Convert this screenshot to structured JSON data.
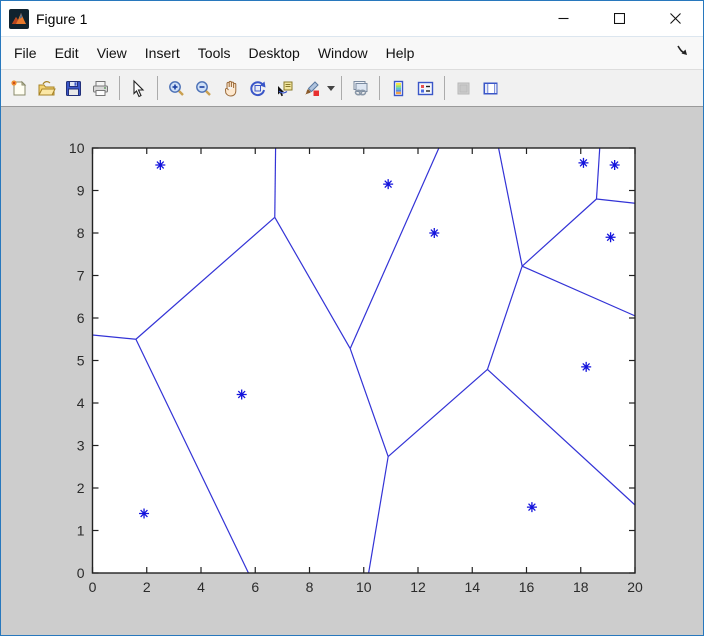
{
  "window": {
    "title": "Figure 1",
    "controls": [
      {
        "name": "minimize"
      },
      {
        "name": "maximize"
      },
      {
        "name": "close"
      }
    ]
  },
  "menu": {
    "items": [
      "File",
      "Edit",
      "View",
      "Insert",
      "Tools",
      "Desktop",
      "Window",
      "Help"
    ]
  },
  "toolbar": {
    "buttons": [
      "new-figure",
      "open-file",
      "save-figure",
      "print-figure",
      "edit-plot",
      "zoom-in",
      "zoom-out",
      "pan",
      "rotate-3d",
      "data-cursor",
      "brush-data",
      "link-plot",
      "insert-colorbar",
      "insert-legend",
      "hide-plot-tools",
      "show-plot-tools"
    ]
  },
  "colors": {
    "window_border": "#2878bd",
    "figure_background": "#cdcdcd",
    "axes_background": "#ffffff",
    "axes_line": "#222222",
    "voronoi_line": "#3333d6",
    "marker": "#1414dc"
  },
  "chart_data": {
    "type": "scatter",
    "title": "",
    "xlabel": "",
    "ylabel": "",
    "xlim": [
      0,
      20
    ],
    "ylim": [
      0,
      10
    ],
    "xticks": [
      0,
      2,
      4,
      6,
      8,
      10,
      12,
      14,
      16,
      18,
      20
    ],
    "yticks": [
      0,
      1,
      2,
      3,
      4,
      5,
      6,
      7,
      8,
      9,
      10
    ],
    "grid": false,
    "legend": null,
    "marker": "*",
    "description": "Voronoi diagram of 10 points, blue asterisk markers with blue cell-boundary lines",
    "points": [
      [
        2.5,
        9.6
      ],
      [
        10.9,
        9.15
      ],
      [
        12.6,
        8.0
      ],
      [
        18.1,
        9.65
      ],
      [
        19.25,
        9.6
      ],
      [
        19.1,
        7.9
      ],
      [
        18.2,
        4.85
      ],
      [
        5.5,
        4.2
      ],
      [
        1.9,
        1.4
      ],
      [
        16.2,
        1.55
      ]
    ],
    "voronoi_edges": [
      [
        [
          0,
          5.6
        ],
        [
          1.6,
          5.5
        ]
      ],
      [
        [
          1.6,
          5.5
        ],
        [
          5.75,
          0
        ]
      ],
      [
        [
          1.6,
          5.5
        ],
        [
          6.72,
          8.37
        ]
      ],
      [
        [
          6.72,
          8.37
        ],
        [
          6.75,
          10
        ]
      ],
      [
        [
          6.72,
          8.37
        ],
        [
          9.5,
          5.28
        ]
      ],
      [
        [
          12.77,
          10
        ],
        [
          9.5,
          5.28
        ]
      ],
      [
        [
          9.5,
          5.28
        ],
        [
          10.9,
          2.74
        ]
      ],
      [
        [
          10.9,
          2.74
        ],
        [
          10.18,
          0
        ]
      ],
      [
        [
          10.9,
          2.74
        ],
        [
          14.56,
          4.79
        ]
      ],
      [
        [
          14.56,
          4.79
        ],
        [
          15.84,
          7.22
        ]
      ],
      [
        [
          14.56,
          4.79
        ],
        [
          20,
          1.6
        ]
      ],
      [
        [
          14.97,
          10
        ],
        [
          15.84,
          7.22
        ]
      ],
      [
        [
          15.84,
          7.22
        ],
        [
          20,
          6.05
        ]
      ],
      [
        [
          15.84,
          7.22
        ],
        [
          18.58,
          8.8
        ]
      ],
      [
        [
          18.58,
          8.8
        ],
        [
          18.7,
          10
        ]
      ],
      [
        [
          18.58,
          8.8
        ],
        [
          20,
          8.7
        ]
      ]
    ]
  }
}
